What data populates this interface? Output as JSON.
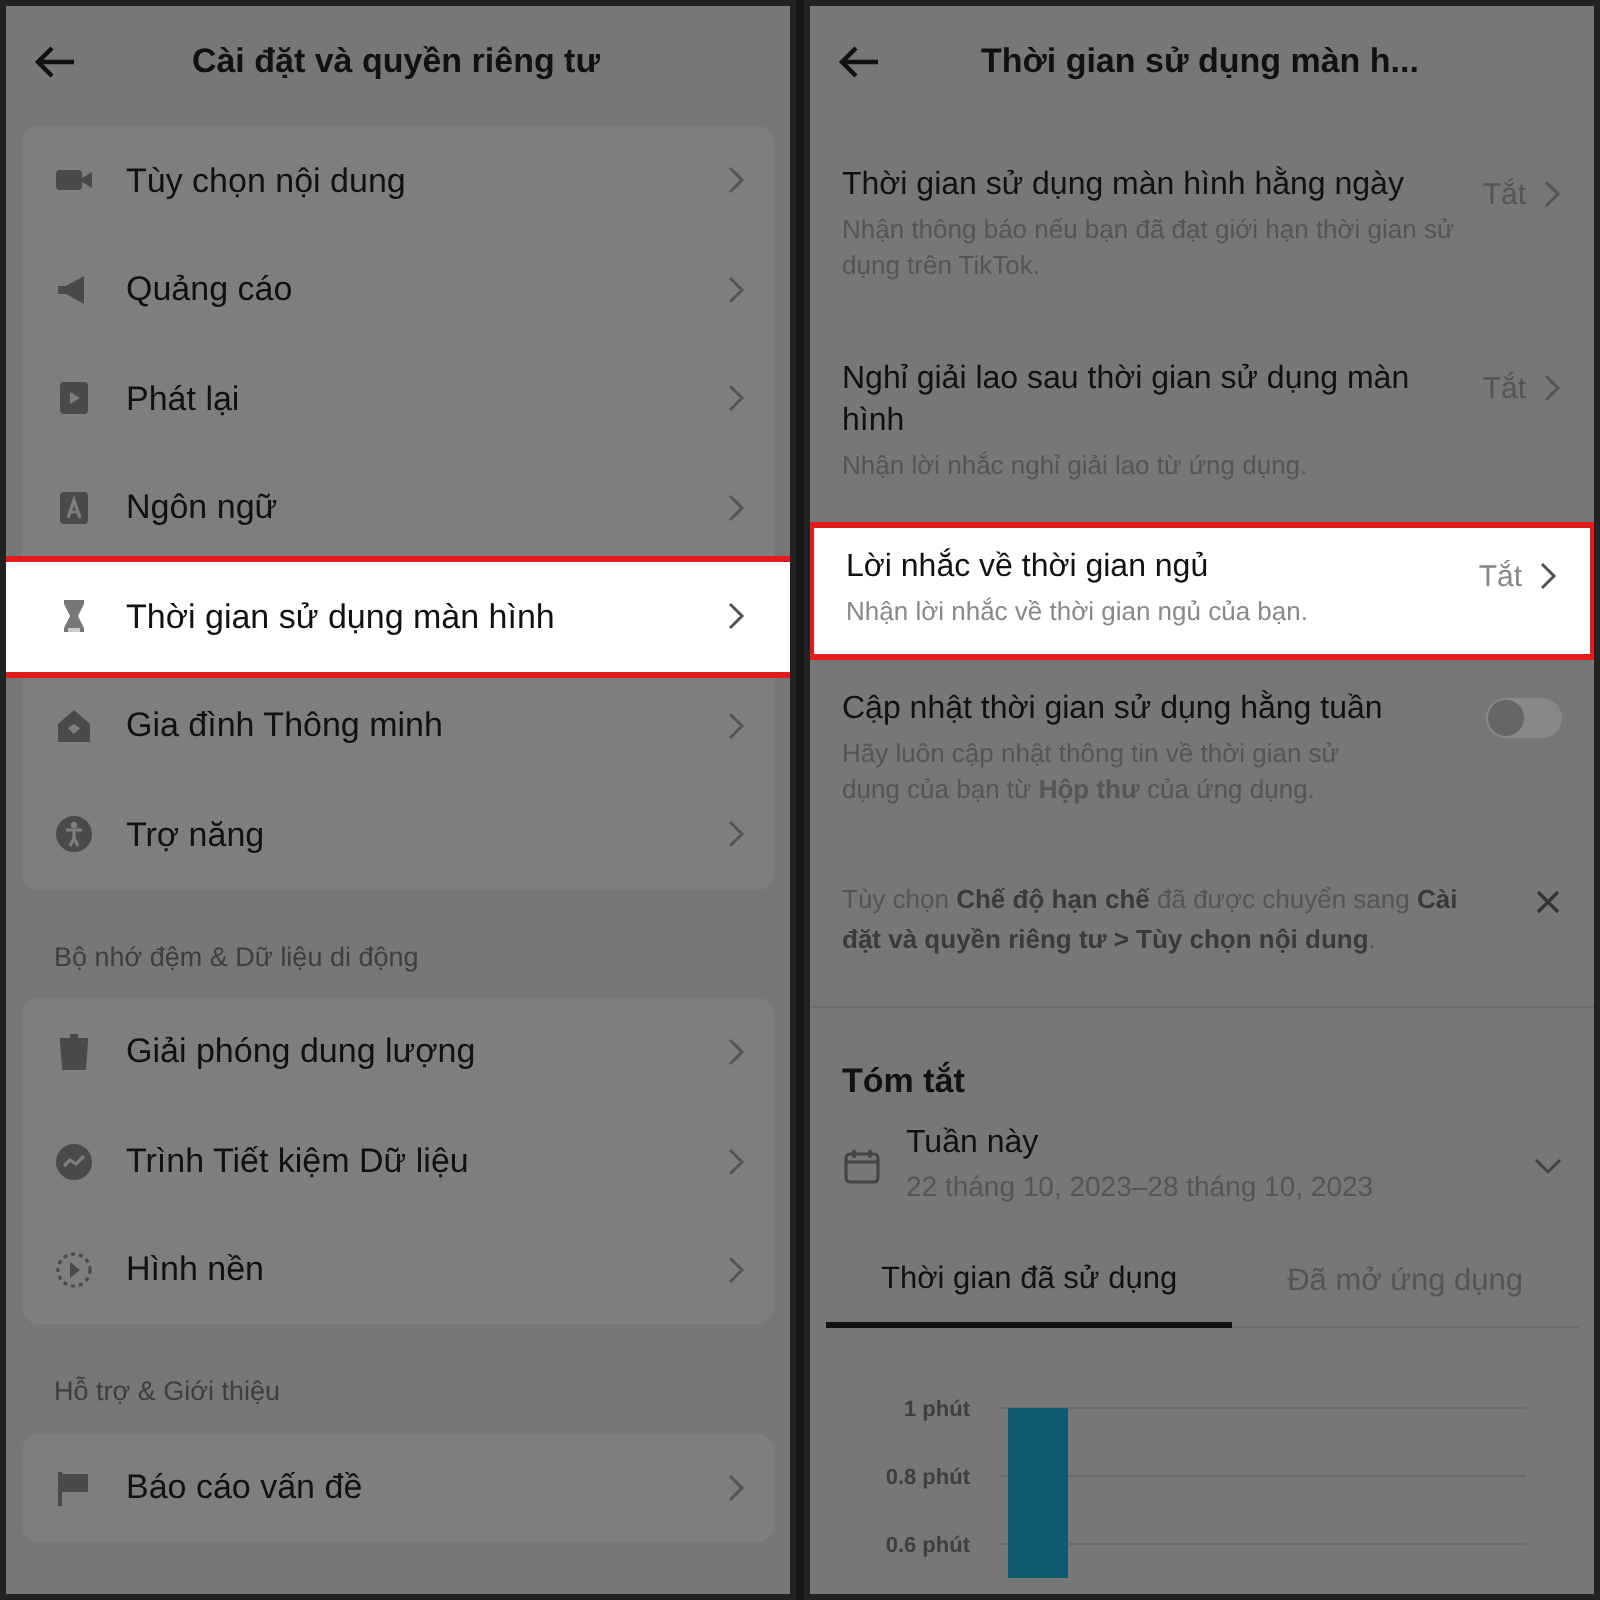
{
  "settings_screen": {
    "title": "Cài đặt và quyền riêng tư",
    "groups": [
      {
        "items": [
          {
            "label": "Tùy chọn nội dung",
            "selected": false
          },
          {
            "label": "Quảng cáo",
            "selected": false
          },
          {
            "label": "Phát lại",
            "selected": false
          },
          {
            "label": "Ngôn ngữ",
            "selected": false
          },
          {
            "label": "Thời gian sử dụng màn hình",
            "selected": true
          },
          {
            "label": "Gia đình Thông minh",
            "selected": false
          },
          {
            "label": "Trợ năng",
            "selected": false
          }
        ]
      },
      {
        "heading": "Bộ nhớ đệm & Dữ liệu di động",
        "items": [
          {
            "label": "Giải phóng dung lượng",
            "selected": false
          },
          {
            "label": "Trình Tiết kiệm Dữ liệu",
            "selected": false
          },
          {
            "label": "Hình nền",
            "selected": false
          }
        ]
      },
      {
        "heading": "Hỗ trợ & Giới thiệu",
        "items": [
          {
            "label": "Báo cáo vấn đề",
            "selected": false
          }
        ]
      }
    ]
  },
  "screen_time_screen": {
    "title": "Thời gian sử dụng màn h...",
    "settings": [
      {
        "kind": "value",
        "title": "Thời gian sử dụng màn hình hằng ngày",
        "description": "Nhận thông báo nếu bạn đã đạt giới hạn thời gian sử dụng trên TikTok.",
        "value": "Tắt",
        "selected": false
      },
      {
        "kind": "value",
        "title": "Nghỉ giải lao sau thời gian sử dụng màn hình",
        "description": "Nhận lời nhắc nghỉ giải lao từ ứng dụng.",
        "value": "Tắt",
        "selected": false
      },
      {
        "kind": "value",
        "title": "Lời nhắc về thời gian ngủ",
        "description": "Nhận lời nhắc về thời gian ngủ của bạn.",
        "value": "Tắt",
        "selected": true
      },
      {
        "kind": "toggle",
        "title": "Cập nhật thời gian sử dụng hằng tuần",
        "description": "Hãy luôn cập nhật thông tin về thời gian sử dụng của bạn từ **Hộp thư** của ứng dụng.",
        "on": false,
        "selected": false
      }
    ],
    "notice": "Tùy chọn **Chế độ hạn chế** đã được chuyển sang **Cài đặt và quyền riêng tư > Tùy chọn nội dung**.",
    "summary": {
      "title": "Tóm tắt",
      "period": "Tuần này",
      "date_range": "22 tháng 10, 2023–28 tháng 10, 2023",
      "tabs": [
        {
          "label": "Thời gian đã sử dụng",
          "selected": true
        },
        {
          "label": "Đã mở ứng dụng",
          "selected": false
        }
      ],
      "chart_data": {
        "type": "bar",
        "values": [
          1
        ],
        "ylim": [
          0.5,
          1
        ],
        "yticks": [
          {
            "value": 1,
            "label": "1 phút"
          },
          {
            "value": 0.8,
            "label": "0.8 phút"
          },
          {
            "value": 0.6,
            "label": "0.6 phút"
          }
        ]
      }
    }
  }
}
